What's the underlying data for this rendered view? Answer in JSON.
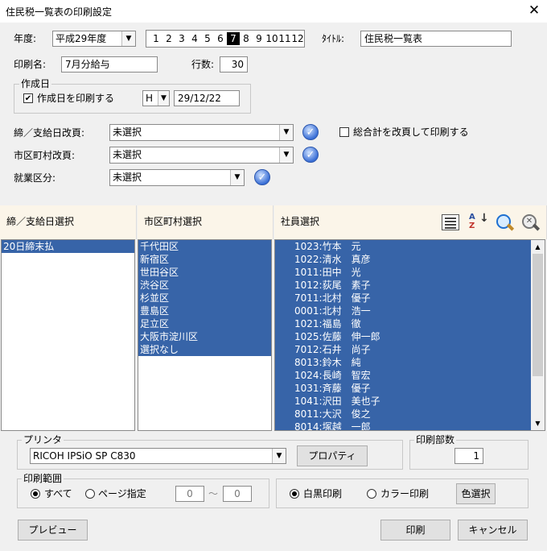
{
  "window": {
    "title": "住民税一覧表の印刷設定",
    "close": "✕"
  },
  "year": {
    "label": "年度:",
    "value": "平成29年度"
  },
  "months": {
    "items": [
      "1",
      "2",
      "3",
      "4",
      "5",
      "6",
      "7",
      "8",
      "9",
      "10",
      "11",
      "12"
    ],
    "selected_index": 6
  },
  "title_field": {
    "label": "ﾀｲﾄﾙ:",
    "value": "住民税一覧表"
  },
  "print_name": {
    "label": "印刷名:",
    "value": "7月分給与"
  },
  "rows": {
    "label": "行数:",
    "value": "30"
  },
  "created_date": {
    "legend": "作成日",
    "checkbox_label": "作成日を印刷する",
    "checked": true,
    "era": "H",
    "date": "29/12/22"
  },
  "closing_page_break": {
    "label": "締／支給日改頁:",
    "value": "未選択"
  },
  "grand_total": {
    "label": "総合計を改頁して印刷する",
    "checked": false
  },
  "city_page_break": {
    "label": "市区町村改頁:",
    "value": "未選択"
  },
  "employment_type": {
    "label": "就業区分:",
    "value": "未選択"
  },
  "lists": {
    "closing_header": "締／支給日選択",
    "closing_items": [
      "20日締末払"
    ],
    "city_header": "市区町村選択",
    "city_items": [
      "千代田区",
      "新宿区",
      "世田谷区",
      "渋谷区",
      "杉並区",
      "豊島区",
      "足立区",
      "大阪市淀川区",
      "選択なし"
    ],
    "employee_header": "社員選択",
    "employee_items": [
      "1023:竹本　元",
      "1022:清水　真彦",
      "1011:田中　光",
      "1012:荻尾　素子",
      "7011:北村　優子",
      "0001:北村　浩一",
      "1021:福島　徹",
      "1025:佐藤　伸一郎",
      "7012:石井　尚子",
      "8013:鈴木　純",
      "1024:長崎　智宏",
      "1031:斉藤　優子",
      "1041:沢田　美也子",
      "8011:大沢　俊之",
      "8014:塚越　一郎"
    ]
  },
  "printer": {
    "legend": "プリンタ",
    "value": "RICOH IPSiO SP C830",
    "properties_button": "プロパティ"
  },
  "copies": {
    "legend": "印刷部数",
    "value": "1"
  },
  "print_range": {
    "legend": "印刷範囲",
    "all_label": "すべて",
    "page_label": "ページ指定",
    "selected": "all",
    "from": "0",
    "tilde": "～",
    "to": "0"
  },
  "color_mode": {
    "mono_label": "白黒印刷",
    "color_label": "カラー印刷",
    "selected": "mono",
    "color_select_button": "色選択"
  },
  "buttons": {
    "preview": "プレビュー",
    "print": "印刷",
    "cancel": "キャンセル"
  },
  "colors": {
    "selection": "#3764a8",
    "list_header_bg": "#fbf5e9",
    "month_active": "#000000"
  }
}
